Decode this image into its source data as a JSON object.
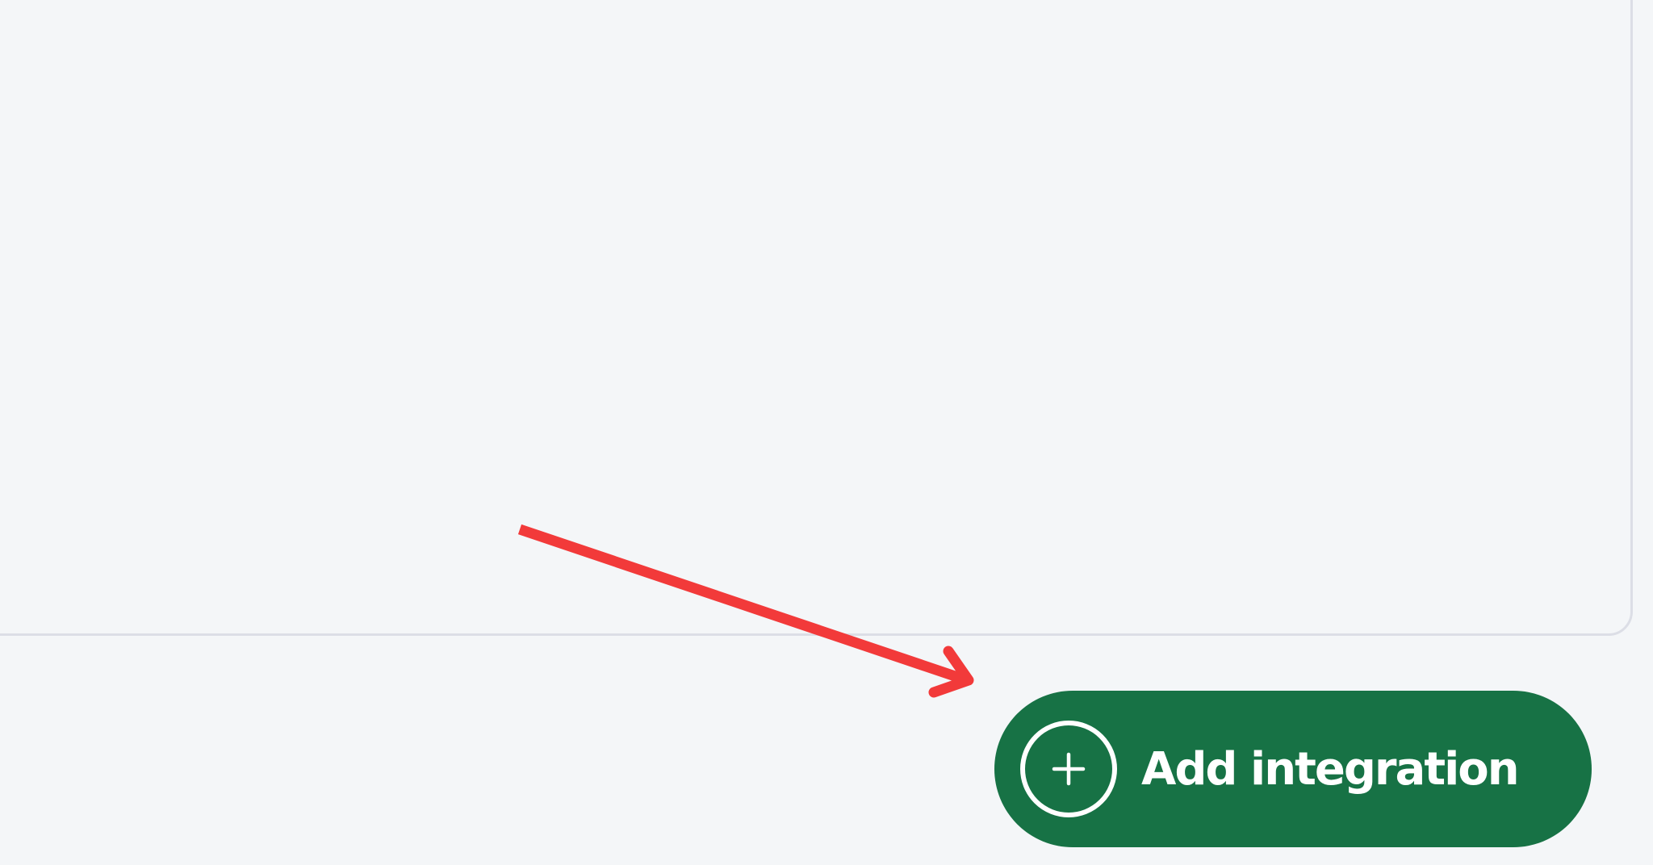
{
  "colors": {
    "background": "#f4f6f8",
    "panel_border": "#dcdee6",
    "button_bg": "#177245",
    "button_text": "#ffffff",
    "annotation_arrow": "#f23a3a"
  },
  "add_integration_button": {
    "label": "Add integration",
    "icon": "plus-circle-icon"
  },
  "annotation": {
    "icon": "arrow-icon"
  }
}
